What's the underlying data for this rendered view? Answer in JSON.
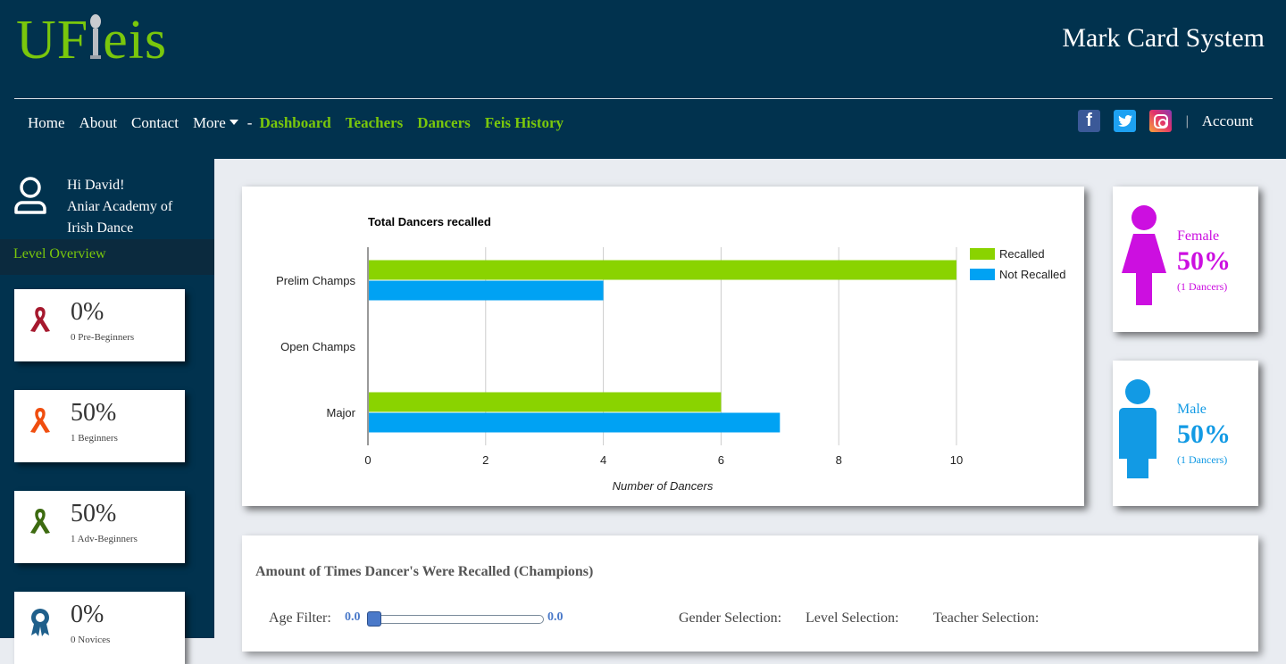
{
  "brand": {
    "logo_prefix": "UF",
    "logo_suffix": "eis",
    "app_title": "Mark Card System"
  },
  "nav": {
    "items": [
      "Home",
      "About",
      "Contact",
      "More",
      "-"
    ],
    "app_items": [
      "Dashboard",
      "Teachers",
      "Dancers",
      "Feis History"
    ],
    "account": "Account",
    "separator": "|"
  },
  "user": {
    "greeting": "Hi David!",
    "school_line1": "Aniar Academy of",
    "school_line2": "Irish Dance"
  },
  "sidebar": {
    "heading": "Level Overview",
    "levels": [
      {
        "pct": "0%",
        "count": "0 Pre-Beginners",
        "color": "#a6192e",
        "icon": "ribbon-icon"
      },
      {
        "pct": "50%",
        "count": "1 Beginners",
        "color": "#f04e0f",
        "icon": "ribbon-icon"
      },
      {
        "pct": "50%",
        "count": "1 Adv-Beginners",
        "color": "#3d6b10",
        "icon": "ribbon-icon"
      },
      {
        "pct": "0%",
        "count": "0 Novices",
        "color": "#1f5f8b",
        "icon": "medal-icon"
      }
    ]
  },
  "chart_data": {
    "type": "bar",
    "orientation": "horizontal",
    "title": "Total Dancers recalled",
    "xlabel": "Number of Dancers",
    "ylabel": "",
    "categories": [
      "Prelim Champs",
      "Open Champs",
      "Major"
    ],
    "series": [
      {
        "name": "Recalled",
        "values": [
          10,
          0,
          6
        ],
        "color": "#8ad300"
      },
      {
        "name": "Not Recalled",
        "values": [
          4,
          0,
          7
        ],
        "color": "#00a2f3"
      }
    ],
    "xlim": [
      0,
      10
    ],
    "xticks": [
      "0",
      "2",
      "4",
      "6",
      "8",
      "10"
    ],
    "grid": true,
    "legend": "top-right"
  },
  "gender": {
    "female": {
      "label": "Female",
      "pct": "50%",
      "count": "(1 Dancers)",
      "color": "#cc0fe0"
    },
    "male": {
      "label": "Male",
      "pct": "50%",
      "count": "(1 Dancers)",
      "color": "#129ae4"
    }
  },
  "recall": {
    "title": "Amount of Times Dancer's Were Recalled (Champions)",
    "age_label": "Age Filter:",
    "age_min": "0.0",
    "age_max": "0.0",
    "gender_label": "Gender Selection:",
    "level_label": "Level Selection:",
    "teacher_label": "Teacher Selection:"
  }
}
